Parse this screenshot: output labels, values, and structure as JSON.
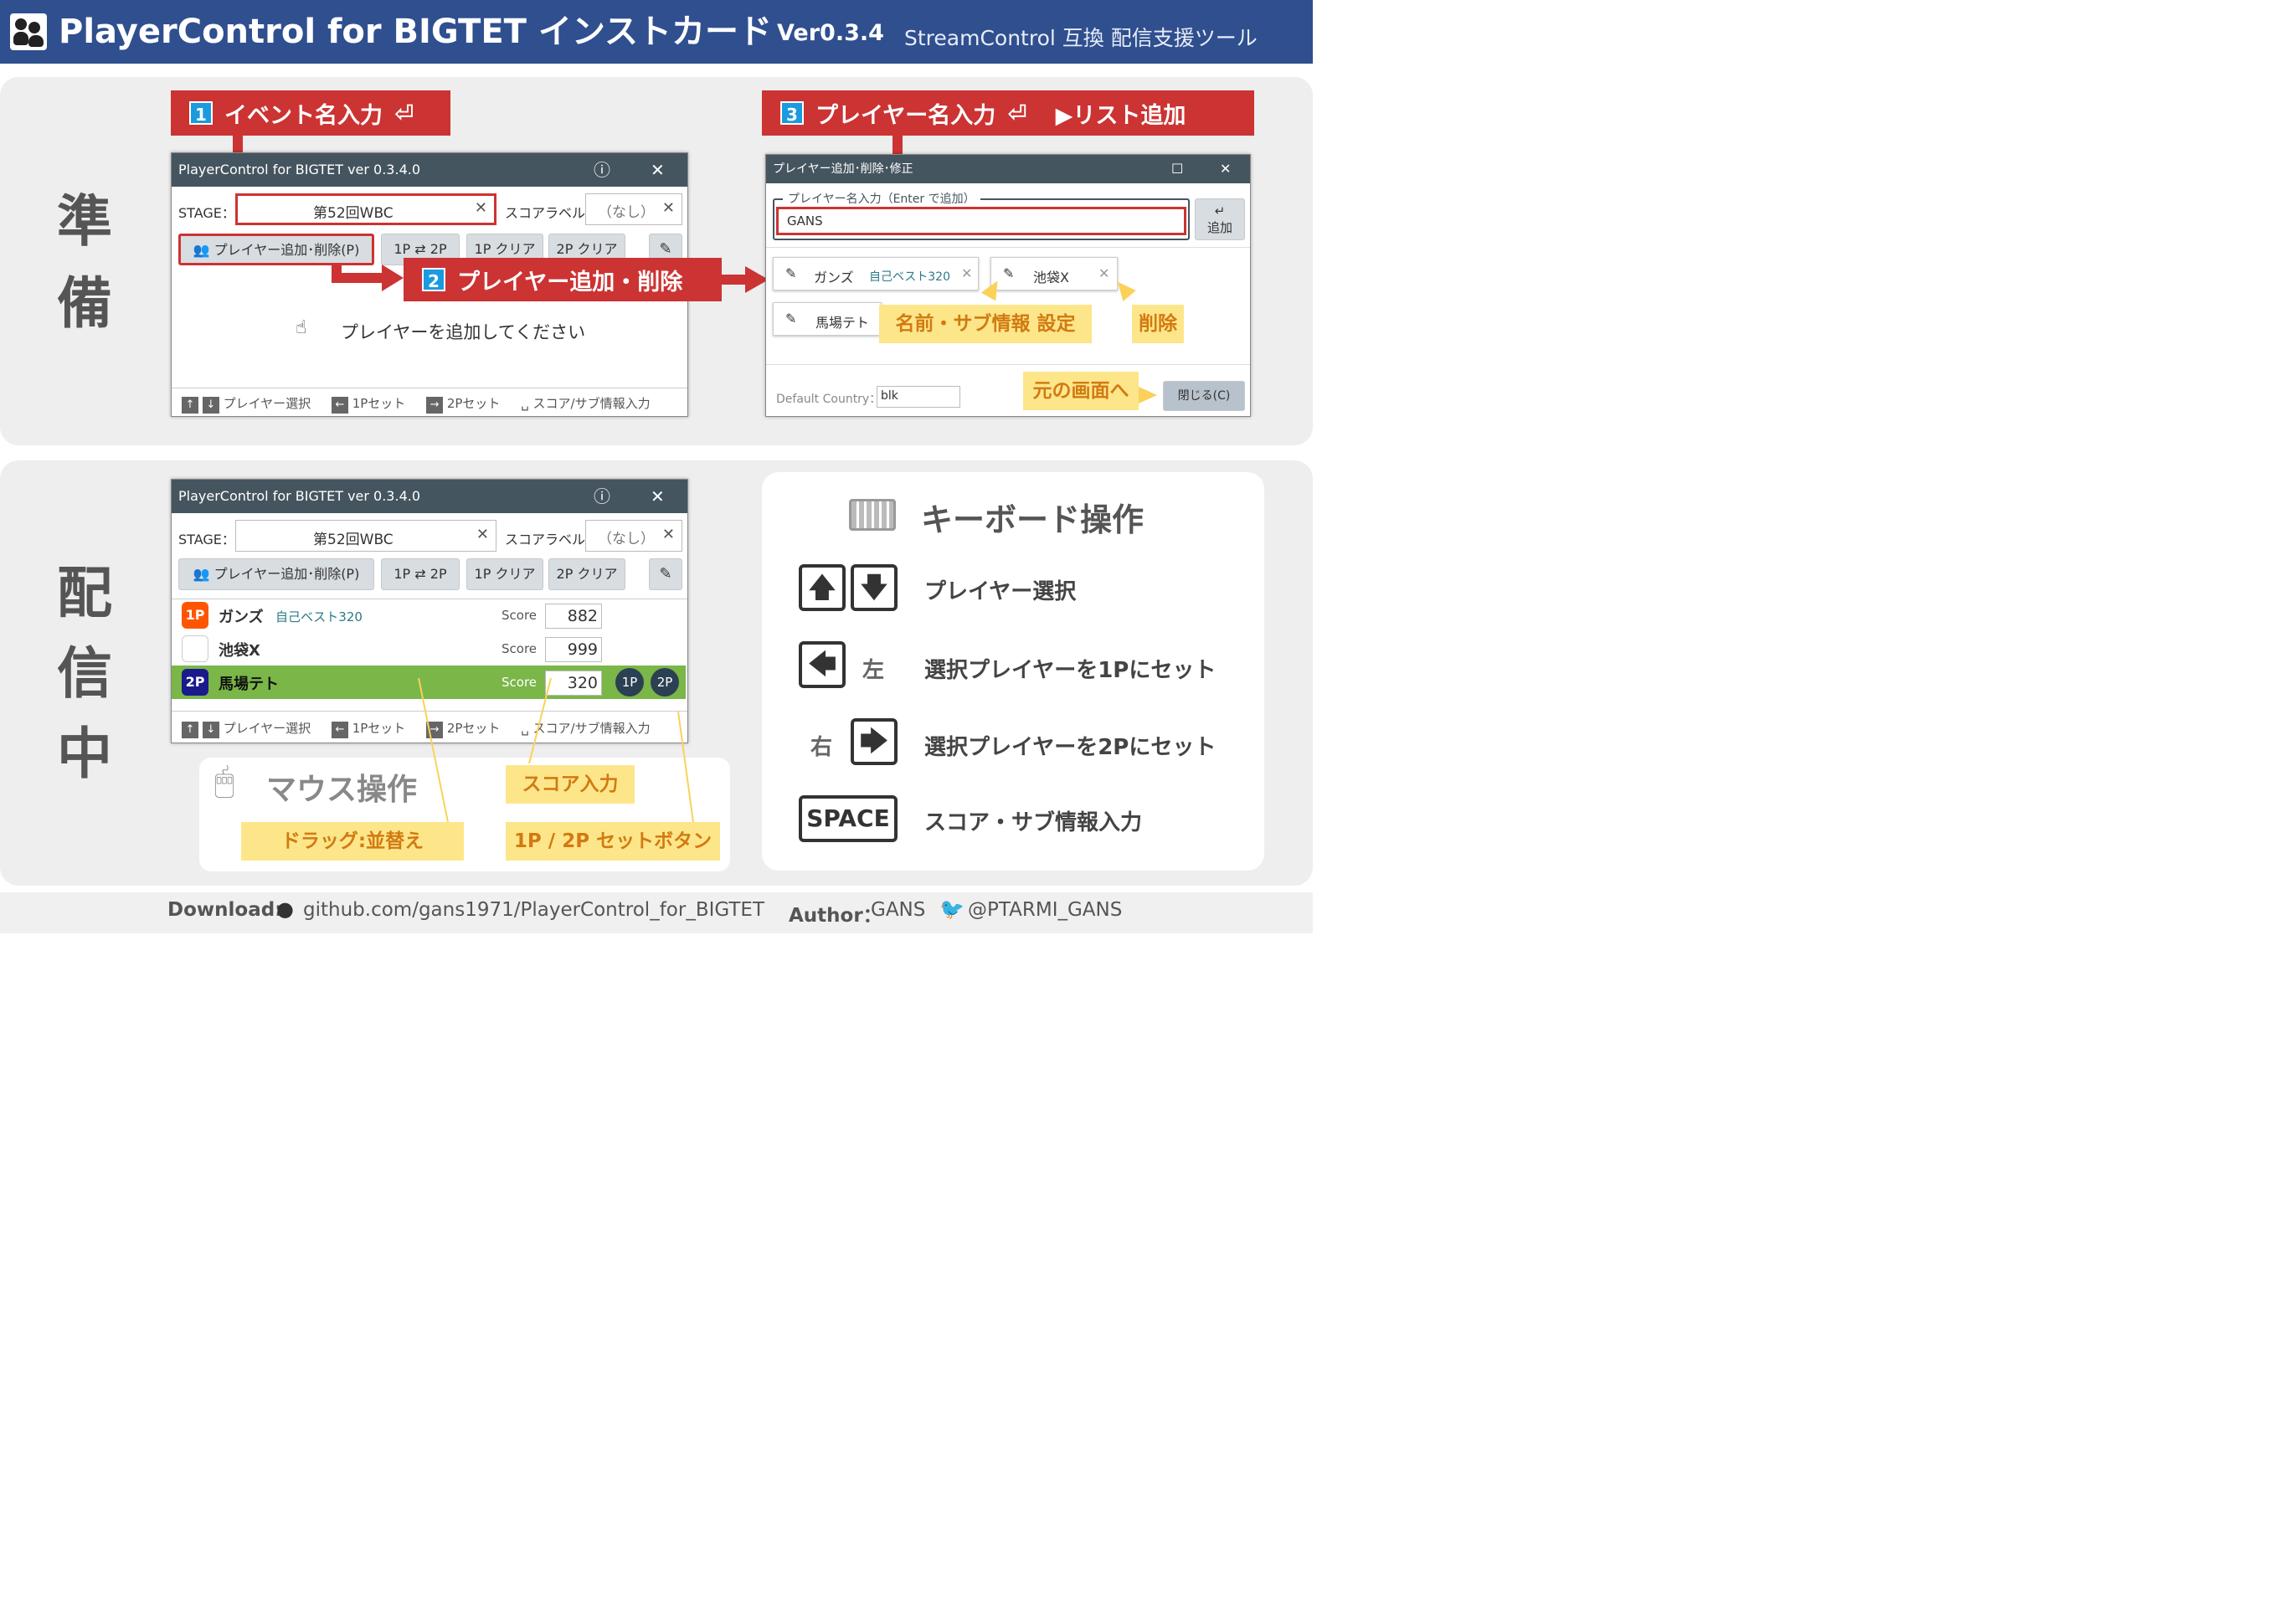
{
  "header": {
    "title": "PlayerControl for BIGTET インストカード",
    "version": "Ver0.3.4",
    "subtitle": "StreamControl 互換 配信支援ツール"
  },
  "sections": {
    "prep_label_1": "準",
    "prep_label_2": "備",
    "live_label_1": "配",
    "live_label_2": "信",
    "live_label_3": "中"
  },
  "steps": {
    "step1_num": "1",
    "step1_label": "イベント名入力",
    "step2_num": "2",
    "step2_label": "プレイヤー追加・削除",
    "step3_num": "3",
    "step3_label": "プレイヤー名入力",
    "step3_extra": "▶リスト追加"
  },
  "main_window": {
    "title": "PlayerControl for BIGTET ver 0.3.4.0",
    "info_icon": "ⓘ",
    "close_icon": "✕",
    "stage_label": "STAGE：",
    "stage_value": "第52回WBC",
    "score_label": "スコアラベル：",
    "score_label_value": "（なし）",
    "add_remove_btn": "プレイヤー追加･削除(P)",
    "swap_btn": "1P ⇄ 2P",
    "clear1_btn": "1P クリア",
    "clear2_btn": "2P クリア",
    "empty_msg": "プレイヤーを追加してください",
    "footer_select": "プレイヤー選択",
    "footer_1p": "1Pセット",
    "footer_2p": "2Pセット",
    "footer_score": "スコア/サブ情報入力"
  },
  "player_dialog": {
    "title": "プレイヤー追加･削除･修正",
    "field_label": "プレイヤー名入力（Enter で追加）",
    "field_value": "GANS",
    "add_btn_icon": "↵",
    "add_btn": "追加",
    "players": [
      {
        "name": "ガンズ",
        "sub": "自己ベスト320"
      },
      {
        "name": "池袋X",
        "sub": ""
      },
      {
        "name": "馬場テト",
        "sub": ""
      }
    ],
    "default_country_label": "Default Country：",
    "default_country_value": "blk",
    "close_btn": "閉じる(C)"
  },
  "yellow_labels": {
    "name_sub": "名前・サブ情報 設定",
    "delete": "削除",
    "back": "元の画面へ",
    "drag": "ドラッグ:並替え",
    "score_input": "スコア入力",
    "set_buttons": "1P / 2P セットボタン"
  },
  "live_window": {
    "rows": [
      {
        "tag": "1P",
        "name": "ガンズ",
        "sub": "自己ベスト320",
        "score_label": "Score",
        "score": "882"
      },
      {
        "tag": "",
        "name": "池袋X",
        "sub": "",
        "score_label": "Score",
        "score": "999"
      },
      {
        "tag": "2P",
        "name": "馬場テト",
        "sub": "",
        "score_label": "Score",
        "score": "320"
      }
    ],
    "btn_1p": "1P",
    "btn_2p": "2P"
  },
  "mouse_panel": {
    "title": "マウス操作"
  },
  "keyboard_panel": {
    "title": "キーボード操作",
    "up_down_desc": "プレイヤー選択",
    "left_label": "左",
    "left_desc": "選択プレイヤーを1Pにセット",
    "right_label": "右",
    "right_desc": "選択プレイヤーを2Pにセット",
    "space_key": "SPACE",
    "space_desc": "スコア・サブ情報入力"
  },
  "footer": {
    "download_label": "Download:",
    "download_url": "github.com/gans1971/PlayerControl_for_BIGTET",
    "author_label": "Author：",
    "author_name": "GANS",
    "twitter": "@PTARMI_GANS"
  },
  "colors": {
    "header_bg": "#2f4f8f",
    "banner_red": "#cc3333",
    "step_blue": "#1a9be0",
    "yellow_bg": "#fde68a",
    "yellow_text": "#d27a12",
    "selected_row": "#7ab648",
    "tag_1p": "#ff5500",
    "tag_2p": "#1a1a8c"
  }
}
